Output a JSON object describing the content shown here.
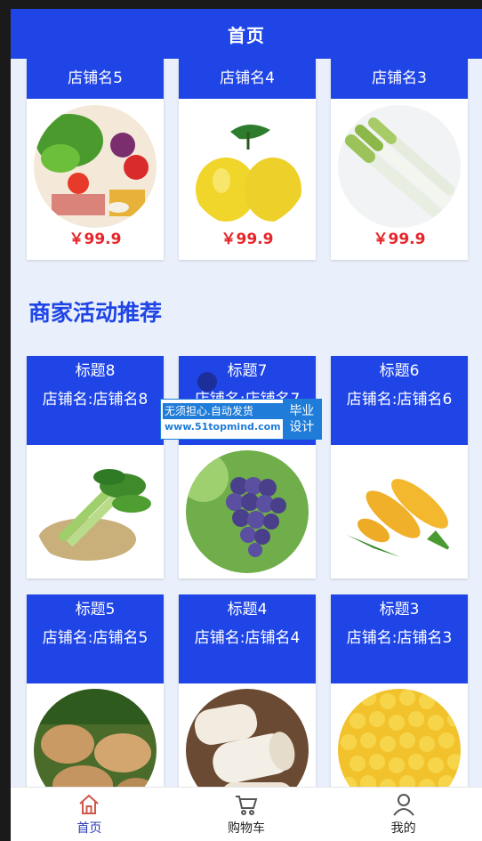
{
  "navbar": {
    "title": "首页"
  },
  "shops": [
    {
      "name": "店铺名5",
      "price": "￥99.9",
      "image": "vegetable-mix"
    },
    {
      "name": "店铺名4",
      "price": "￥99.9",
      "image": "pomelo"
    },
    {
      "name": "店铺名3",
      "price": "￥99.9",
      "image": "leek"
    }
  ],
  "section": {
    "title": "商家活动推荐"
  },
  "activities": [
    {
      "title": "标题8",
      "shop": "店铺名:店铺名8",
      "image": "lettuce"
    },
    {
      "title": "标题7",
      "shop": "店铺名:店铺名7",
      "image": "grapes"
    },
    {
      "title": "标题6",
      "shop": "店铺名:店铺名6",
      "image": "corn"
    },
    {
      "title": "标题5",
      "shop": "店铺名:店铺名5",
      "image": "potato"
    },
    {
      "title": "标题4",
      "shop": "店铺名:店铺名4",
      "image": "yam"
    },
    {
      "title": "标题3",
      "shop": "店铺名:店铺名3",
      "image": "corn-kernels"
    }
  ],
  "watermark": {
    "line1": "无须担心.自动发货",
    "line2": "www.51topmind.com",
    "right1": "毕业",
    "right2": "设计"
  },
  "tabbar": [
    {
      "label": "首页",
      "icon": "home-icon",
      "active": true
    },
    {
      "label": "购物车",
      "icon": "cart-icon",
      "active": false
    },
    {
      "label": "我的",
      "icon": "user-icon",
      "active": false
    }
  ],
  "colors": {
    "primary": "#1f45e6",
    "price": "#e8252a",
    "background": "#eaf0fb"
  }
}
